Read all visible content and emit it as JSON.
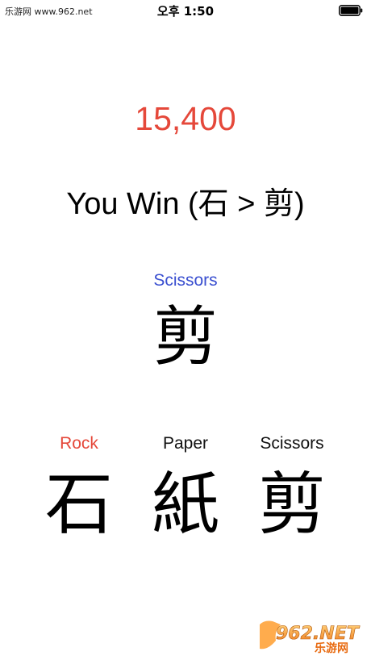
{
  "status_bar": {
    "watermark": "乐游网 www.962.net",
    "time": "오후 1:50",
    "battery_icon": "battery-full-icon"
  },
  "game": {
    "score": "15,400",
    "result": "You Win (石 > 剪)",
    "computer_choice": {
      "label": "Scissors",
      "glyph": "剪",
      "label_color": "#3a4fd0"
    },
    "choices": [
      {
        "label": "Rock",
        "glyph": "石",
        "selected": true
      },
      {
        "label": "Paper",
        "glyph": "紙",
        "selected": false
      },
      {
        "label": "Scissors",
        "glyph": "剪",
        "selected": false
      }
    ],
    "score_color": "#e5483a",
    "selected_color": "#e5483a"
  },
  "logo": {
    "brand": "962.NET",
    "name": "乐游网"
  }
}
